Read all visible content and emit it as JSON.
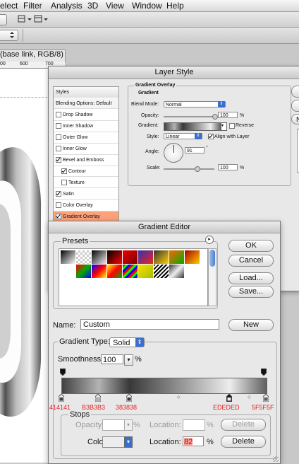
{
  "menubar": {
    "items": [
      "elect",
      "Filter",
      "Analysis",
      "3D",
      "View",
      "Window",
      "Help"
    ]
  },
  "document": {
    "tab_title": "(base link, RGB/8) *",
    "ruler_marks": [
      "00",
      "600",
      "700"
    ]
  },
  "layer_style": {
    "title": "Layer Style",
    "styles_header": "Styles",
    "blending_options": "Blending Options: Default",
    "effects": [
      {
        "label": "Drop Shadow",
        "checked": false
      },
      {
        "label": "Inner Shadow",
        "checked": false
      },
      {
        "label": "Outer Glow",
        "checked": false
      },
      {
        "label": "Inner Glow",
        "checked": false
      },
      {
        "label": "Bevel and Emboss",
        "checked": true
      },
      {
        "label": "Contour",
        "checked": true
      },
      {
        "label": "Texture",
        "checked": false
      },
      {
        "label": "Satin",
        "checked": true
      },
      {
        "label": "Color Overlay",
        "checked": false
      },
      {
        "label": "Gradient Overlay",
        "checked": true
      }
    ],
    "section_title": "Gradient Overlay",
    "subsection_title": "Gradient",
    "blend_mode_label": "Blend Mode:",
    "blend_mode_value": "Normal",
    "opacity_label": "Opacity:",
    "opacity_value": "100",
    "opacity_unit": "%",
    "gradient_label": "Gradient:",
    "reverse_label": "Reverse",
    "style_label": "Style:",
    "style_value": "Linear",
    "align_label": "Align with Layer",
    "angle_label": "Angle:",
    "angle_value": "91",
    "angle_unit": "°",
    "scale_label": "Scale:",
    "scale_value": "100",
    "scale_unit": "%",
    "side_button_partial": "N"
  },
  "gradient_editor": {
    "title": "Gradient Editor",
    "presets_label": "Presets",
    "ok_label": "OK",
    "cancel_label": "Cancel",
    "load_label": "Load...",
    "save_label": "Save...",
    "name_label": "Name:",
    "name_value": "Custom",
    "new_label": "New",
    "gradient_type_label": "Gradient Type:",
    "gradient_type_value": "Solid",
    "smoothness_label": "Smoothness:",
    "smoothness_value": "100",
    "smoothness_unit": "%",
    "stops_label": "Stops",
    "opacity_label": "Opacity:",
    "opacity_unit": "%",
    "location_label": "Location:",
    "location_unit": "%",
    "delete_label": "Delete",
    "color_label": "Color:",
    "color_location_value": "82",
    "color_location_unit": "%",
    "color_delete_label": "Delete",
    "stop_annotations": [
      "414141",
      "B3B3B3",
      "383838",
      "EDEDED",
      "5F5F5F"
    ],
    "gradient_stop_colors": [
      "#414141",
      "#B3B3B3",
      "#383838",
      "#EDEDED",
      "#5F5F5F"
    ],
    "gradient_stop_locations": [
      0,
      18,
      33,
      82,
      100
    ]
  }
}
